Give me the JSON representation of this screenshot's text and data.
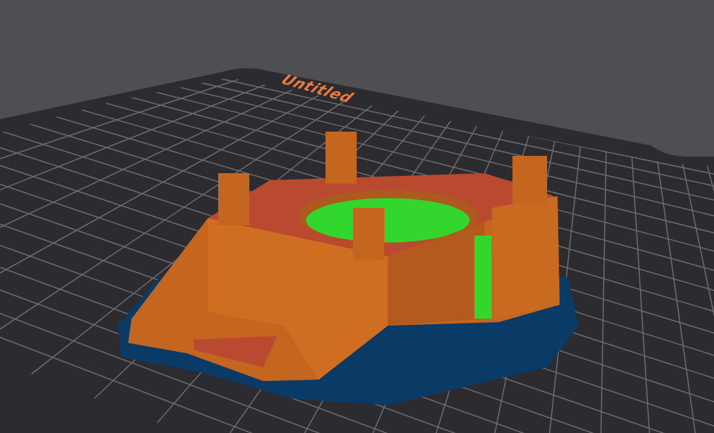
{
  "viewport": {
    "plate_label": "Untitled"
  }
}
